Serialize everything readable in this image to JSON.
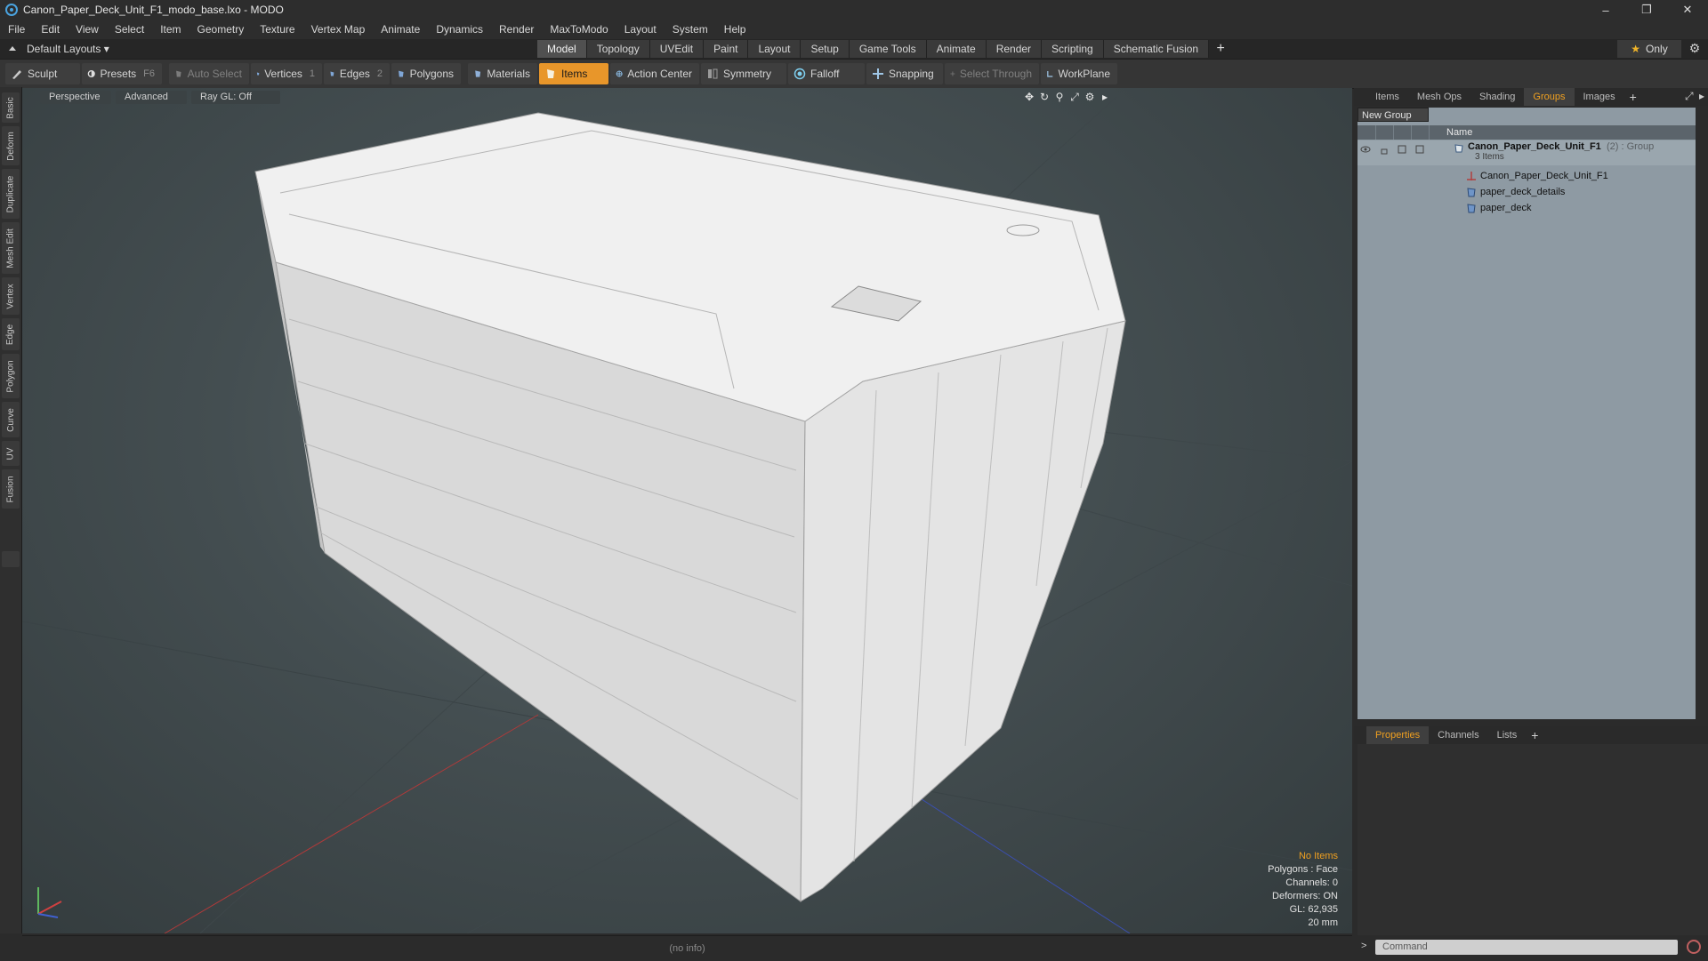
{
  "window": {
    "title": "Canon_Paper_Deck_Unit_F1_modo_base.lxo - MODO",
    "controls": [
      "–",
      "❐",
      "✕"
    ]
  },
  "menu": [
    "File",
    "Edit",
    "View",
    "Select",
    "Item",
    "Geometry",
    "Texture",
    "Vertex Map",
    "Animate",
    "Dynamics",
    "Render",
    "MaxToModo",
    "Layout",
    "System",
    "Help"
  ],
  "layout_bar": {
    "layout_selector": "Default Layouts ▾",
    "mode_tabs": [
      "Model",
      "Topology",
      "UVEdit",
      "Paint",
      "Layout",
      "Setup",
      "Game Tools",
      "Animate",
      "Render",
      "Scripting",
      "Schematic Fusion"
    ],
    "active_mode": "Model",
    "add_tab": "+",
    "only_label": "Only"
  },
  "toolbar": {
    "sculpt": "Sculpt",
    "presets": "Presets",
    "presets_key": "F6",
    "auto_select": "Auto Select",
    "vertices": "Vertices",
    "vertices_count": "1",
    "edges": "Edges",
    "edges_count": "2",
    "polygons": "Polygons",
    "materials": "Materials",
    "items": "Items",
    "action_center": "Action Center",
    "symmetry": "Symmetry",
    "falloff": "Falloff",
    "snapping": "Snapping",
    "select_through": "Select Through",
    "workplane": "WorkPlane"
  },
  "left_tabs": [
    "Basic",
    "Deform",
    "Duplicate",
    "Mesh Edit",
    "Vertex",
    "Edge",
    "Polygon",
    "Curve",
    "UV",
    "Fusion"
  ],
  "viewport": {
    "view_type": "Perspective",
    "shading": "Advanced",
    "raygl": "Ray GL: Off",
    "info": {
      "selection": "No Items",
      "polygons": "Polygons : Face",
      "channels": "Channels: 0",
      "deformers": "Deformers: ON",
      "gl": "GL: 62,935",
      "scale": "20 mm"
    }
  },
  "status_bar": "(no info)",
  "right_panel": {
    "top_tabs": [
      "Items",
      "Mesh Ops",
      "Shading",
      "Groups",
      "Images"
    ],
    "active_top_tab": "Groups",
    "new_group": "New Group",
    "name_header": "Name",
    "tree": {
      "group_name": "Canon_Paper_Deck_Unit_F1",
      "group_suffix": " (2) : Group",
      "group_sub": "3 Items",
      "children": [
        "Canon_Paper_Deck_Unit_F1",
        "paper_deck_details",
        "paper_deck"
      ]
    },
    "bottom_tabs": [
      "Properties",
      "Channels",
      "Lists"
    ],
    "active_bottom_tab": "Properties",
    "command_placeholder": "Command",
    "command_prompt": ">"
  },
  "colors": {
    "accent": "#e8962a",
    "active_tab_text": "#f0a020",
    "viewport_bg": "#444e51",
    "groups_bg": "#8e9aa3"
  }
}
